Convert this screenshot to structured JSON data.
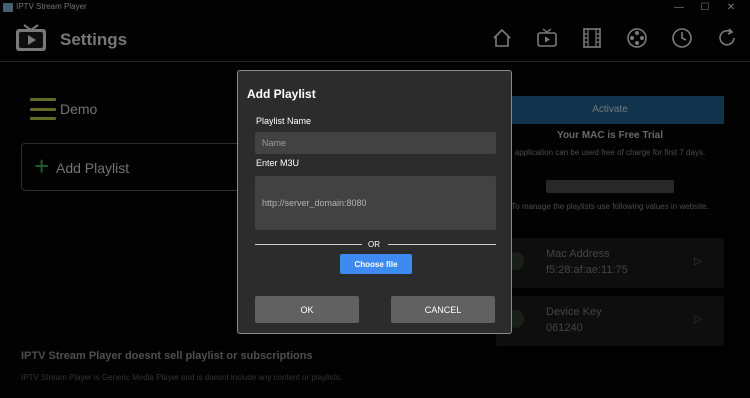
{
  "window": {
    "title": "IPTV Stream Player",
    "minimize": "—",
    "maximize": "☐",
    "close": "✕"
  },
  "header": {
    "title": "Settings"
  },
  "sidebar": {
    "demo_label": "Demo",
    "add_playlist_label": "Add Playlist"
  },
  "right_panel": {
    "activate_label": "Activate",
    "mac_status": "Your MAC is Free Trial",
    "trial_text": "application can be used free of charge for first 7 days.",
    "gray_button_label": "",
    "manage_text": "To manage the playlists use following values in website.",
    "mac_label": "Mac Address",
    "mac_value": "f5:28:af:ae:11:75",
    "key_label": "Device Key",
    "key_value": "061240"
  },
  "footer": {
    "title": "IPTV Stream Player doesnt sell playlist or subscriptions",
    "text": "IPTV Stream Player is Generic Media Player and is doesnt include any content or playlists."
  },
  "dialog": {
    "title": "Add Playlist",
    "name_label": "Playlist Name",
    "name_placeholder": "Name",
    "m3u_label": "Enter M3U",
    "m3u_placeholder": "http://server_domain:8080",
    "or_text": "OR",
    "choose_file_label": "Choose file",
    "ok_label": "OK",
    "cancel_label": "CANCEL"
  },
  "colors": {
    "accent": "#3d8bf0",
    "plus": "#3fae4a",
    "menu": "#b5c34a",
    "dialog_bg": "#2c2c2c"
  }
}
